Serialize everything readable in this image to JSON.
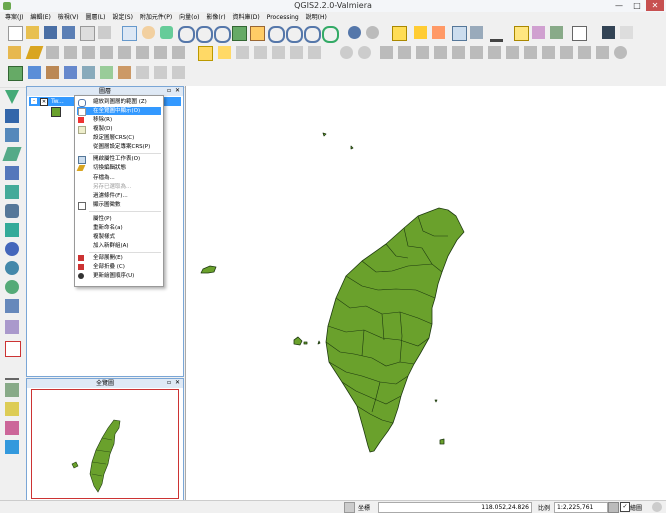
{
  "window": {
    "title": "QGIS2.2.0-Valmiera",
    "minimize": "—",
    "maximize": "□",
    "close": "✕"
  },
  "menu": [
    "專案(J)",
    "編輯(E)",
    "檢視(V)",
    "圖層(L)",
    "設定(S)",
    "附加元件(P)",
    "向量(o)",
    "影像(r)",
    "資料庫(D)",
    "Processing",
    "說明(H)"
  ],
  "layers_panel": {
    "title": "圖層",
    "layer_name": "Tw..."
  },
  "overview_panel": {
    "title": "全覽圖"
  },
  "context_menu": {
    "items": [
      {
        "label": "縮放到圖層的範圍 (Z)",
        "state": "normal",
        "icon": "zoom-icon"
      },
      {
        "label": "在全覽圖中顯示(O)",
        "state": "selected",
        "icon": "overview-icon"
      },
      {
        "label": "移除(R)",
        "state": "normal",
        "icon": "remove-icon"
      },
      {
        "label": "複製(D)",
        "state": "normal",
        "icon": "duplicate-icon"
      },
      {
        "label": "設定圖層CRS(C)",
        "state": "normal",
        "icon": "none"
      },
      {
        "label": "從圖層設定專案CRS(P)",
        "state": "normal",
        "icon": "none"
      },
      {
        "label": "開啟屬性工作表(O)",
        "state": "normal",
        "icon": "table-icon"
      },
      {
        "label": "切換編輯狀態",
        "state": "normal",
        "icon": "pencil-icon"
      },
      {
        "label": "存檔為...",
        "state": "normal",
        "icon": "none"
      },
      {
        "label": "另存已選取為...",
        "state": "disabled",
        "icon": "none"
      },
      {
        "label": "過濾條件(F)...",
        "state": "normal",
        "icon": "none"
      },
      {
        "label": "顯示圖徵數",
        "state": "normal",
        "icon": "none"
      },
      {
        "label": "屬性(P)",
        "state": "normal",
        "icon": "none"
      },
      {
        "label": "重新命名(a)",
        "state": "normal",
        "icon": "none"
      },
      {
        "label": "複製樣式",
        "state": "normal",
        "icon": "none"
      },
      {
        "label": "加入新群組(A)",
        "state": "normal",
        "icon": "none"
      },
      {
        "label": "全部展開(E)",
        "state": "normal",
        "icon": "expand-icon"
      },
      {
        "label": "全部折疊 (C)",
        "state": "normal",
        "icon": "collapse-icon"
      },
      {
        "label": "更新繪圖順序(U)",
        "state": "normal",
        "icon": "order-icon"
      }
    ]
  },
  "statusbar": {
    "coord_label": "坐標",
    "coord_value": "118.052,24.826",
    "scale_label": "比例",
    "scale_value": "1:2,225,761",
    "render_label": "繪圖"
  },
  "colors": {
    "map_fill": "#6aa12c",
    "map_stroke": "#1e3a10",
    "selection": "#3399ff",
    "panel_border": "#7aa6d6"
  }
}
